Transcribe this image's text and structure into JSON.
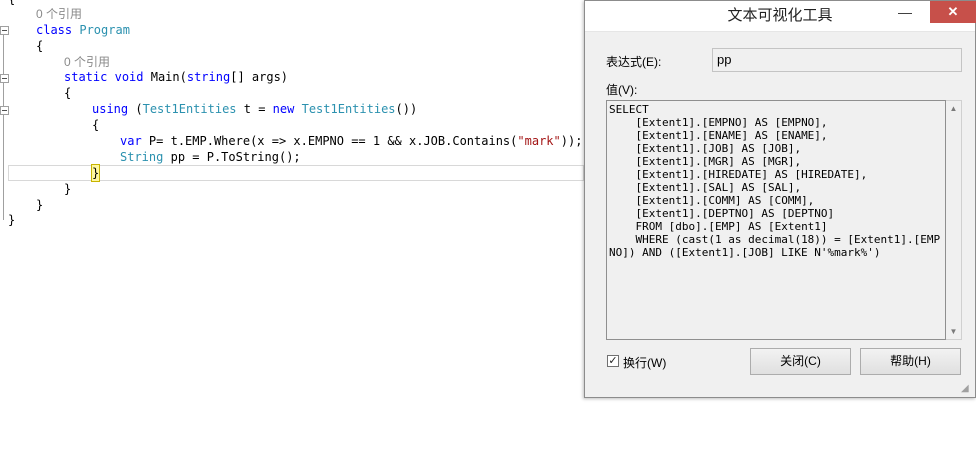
{
  "editor": {
    "lines": {
      "top_brace": "{",
      "ref1": "0 个引用",
      "class_kw": "class",
      "class_name": "Program",
      "brace_open_1": "{",
      "ref2": "0 个引用",
      "static_kw": "static",
      "void_kw": "void",
      "main_sig": "Main(",
      "string_kw": "string",
      "main_args": "[] args)",
      "brace_open_2": "{",
      "using_kw": "using",
      "using_open": "(",
      "entities_type": "Test1Entities",
      "using_var": "t =",
      "new_kw": "new",
      "entities_type2": "Test1Entities",
      "using_close": "())",
      "brace_open_3": "{",
      "var_kw": "var",
      "linq_pre": "P= t.EMP.Where(x => x.EMPNO == 1 && x.JOB.Contains(",
      "linq_str": "\"mark\"",
      "linq_post": "));",
      "string_type": "String",
      "pp_line": "pp = P.ToString();",
      "brace_close_3": "}",
      "brace_close_2": "}",
      "brace_close_1": "}",
      "brace_close_0": "}"
    }
  },
  "dialog": {
    "title": "文本可视化工具",
    "minimize_glyph": "—",
    "close_glyph": "✕",
    "expression_label": "表达式(E):",
    "expression_value": "pp",
    "value_label": "值(V):",
    "value_text": "SELECT \n    [Extent1].[EMPNO] AS [EMPNO], \n    [Extent1].[ENAME] AS [ENAME], \n    [Extent1].[JOB] AS [JOB], \n    [Extent1].[MGR] AS [MGR], \n    [Extent1].[HIREDATE] AS [HIREDATE], \n    [Extent1].[SAL] AS [SAL], \n    [Extent1].[COMM] AS [COMM], \n    [Extent1].[DEPTNO] AS [DEPTNO]\n    FROM [dbo].[EMP] AS [Extent1]\n    WHERE (cast(1 as decimal(18)) = [Extent1].[EMPNO]) AND ([Extent1].[JOB] LIKE N'%mark%')",
    "wrap_checked": true,
    "wrap_label": "换行(W)",
    "close_button": "关闭(C)",
    "help_button": "帮助(H)"
  },
  "colors": {
    "keyword": "#0000ff",
    "type": "#2b91af",
    "string": "#a31515",
    "reference": "#8a8a8a",
    "close_button": "#c7504a"
  },
  "icons": [
    "collapse-icon",
    "minimize-icon",
    "close-icon",
    "scroll-up-icon",
    "scroll-down-icon",
    "resize-grip-icon",
    "checkmark-icon"
  ]
}
